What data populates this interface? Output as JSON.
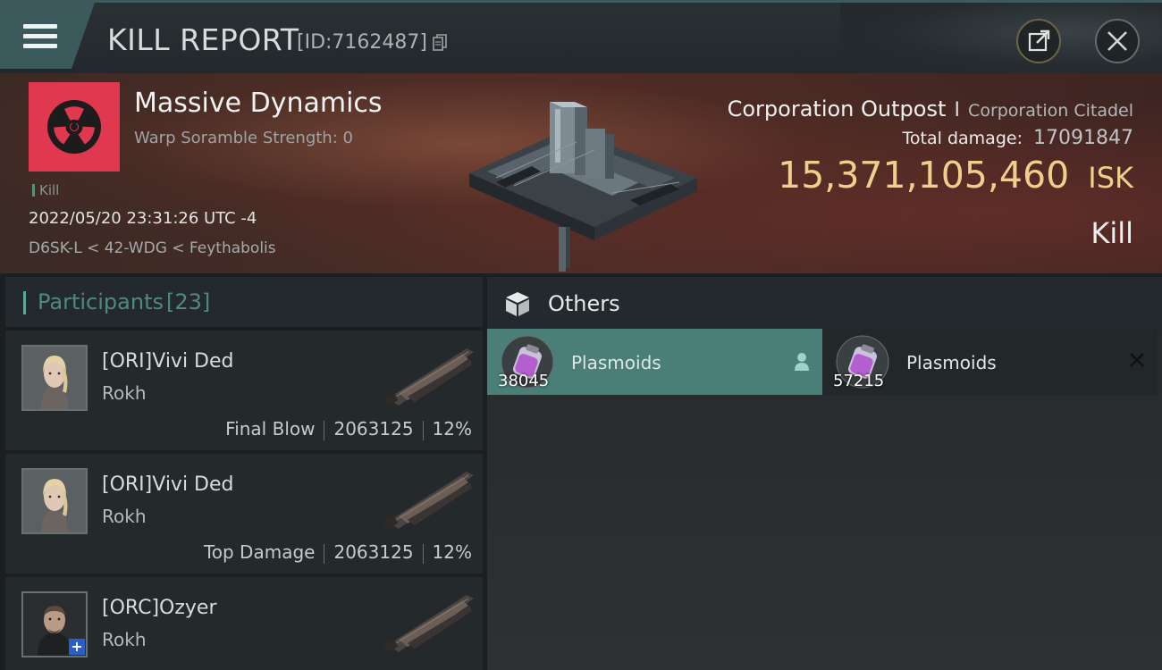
{
  "topbar": {
    "title": "KILL REPORT",
    "report_id": "[ID:7162487]"
  },
  "victim": {
    "corp_name": "Massive Dynamics",
    "warp_scramble": "Warp Soramble Strength: 0",
    "kill_tag": "Kill",
    "datetime": "2022/05/20 23:31:26 UTC -4",
    "location": "D6SK-L < 42-WDG < Feythabolis",
    "logo_color": "#e0394f"
  },
  "target": {
    "type": "Corporation Outpost",
    "separator": "I",
    "class": "Corporation Citadel",
    "total_damage_label": "Total damage:",
    "total_damage_value": "17091847",
    "isk_value": "15,371,105,460",
    "isk_unit": "ISK",
    "result": "Kill",
    "isk_color": "#f0cf8c"
  },
  "participants": {
    "label": "Participants",
    "count": "[23]",
    "rows": [
      {
        "name": "[ORI]Vivi Ded",
        "ship": "Rokh",
        "tag": "Final Blow",
        "damage": "2063125",
        "percent": "12%"
      },
      {
        "name": "[ORI]Vivi Ded",
        "ship": "Rokh",
        "tag": "Top Damage",
        "damage": "2063125",
        "percent": "12%"
      },
      {
        "name": "[ORC]Ozyer",
        "ship": "Rokh"
      }
    ]
  },
  "others": {
    "title": "Others",
    "items": [
      {
        "name": "Plasmoids",
        "qty": "38045",
        "icon": "person-icon"
      },
      {
        "name": "Plasmoids",
        "qty": "57215",
        "icon": "x-icon"
      }
    ],
    "accent": "#4a7f78"
  }
}
